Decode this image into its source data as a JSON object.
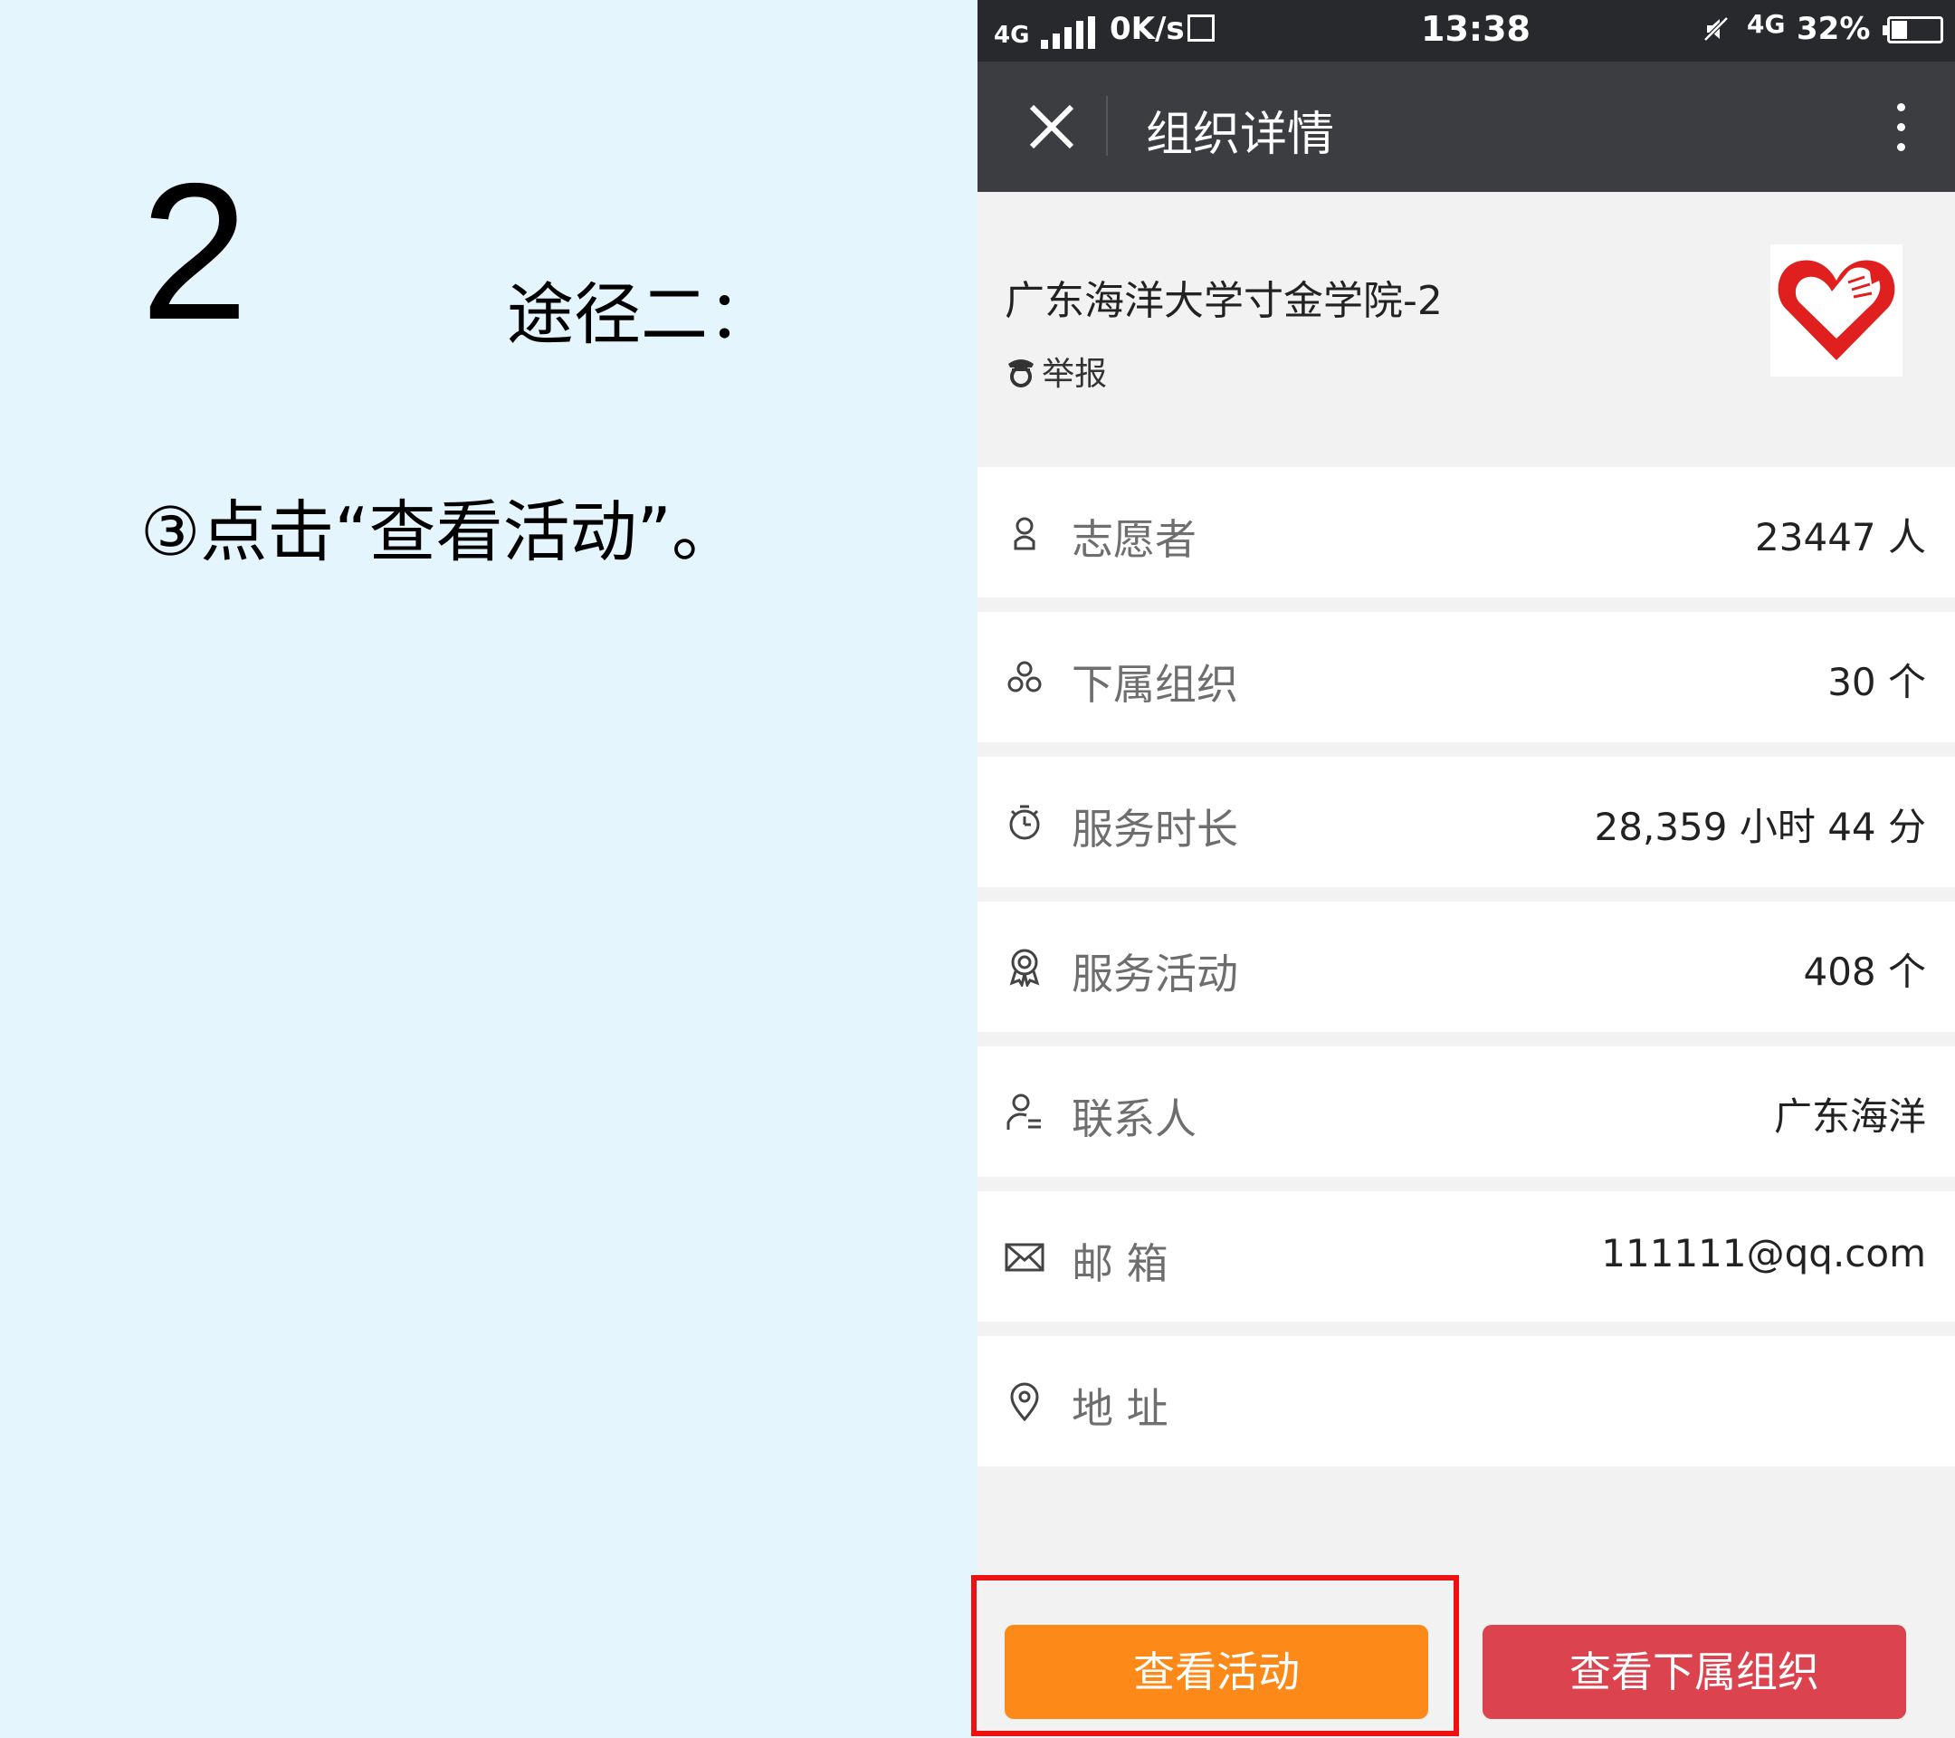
{
  "slide": {
    "step_number": "2",
    "route_title": "途径二：",
    "instruction": "③点击“查看活动”。"
  },
  "status_bar": {
    "signal_type": "4G",
    "speed": "0K/s",
    "time": "13:38",
    "network": "4G",
    "battery_percent": "32%",
    "battery_level": 0.32,
    "icons": [
      "signal-bars-icon",
      "screenshot-icon",
      "mute-icon",
      "battery-icon"
    ]
  },
  "nav": {
    "title": "组织详情",
    "close_icon": "close-icon",
    "more_icon": "more-vertical-icon",
    "background": "#3c3d41"
  },
  "organization": {
    "name": "广东海洋大学寸金学院-2",
    "report_label": "举报",
    "report_icon": "police-badge-icon",
    "logo_icon": "volunteer-heart-hand-logo"
  },
  "info_rows": [
    {
      "icon": "person-icon",
      "label": "志愿者",
      "value": "23447 人"
    },
    {
      "icon": "organization-icon",
      "label": "下属组织",
      "value": "30 个"
    },
    {
      "icon": "stopwatch-icon",
      "label": "服务时长",
      "value": "28,359 小时 44 分"
    },
    {
      "icon": "medal-icon",
      "label": "服务活动",
      "value": "408 个"
    },
    {
      "icon": "contact-person-icon",
      "label": "联系人",
      "value": "广东海洋"
    },
    {
      "icon": "mail-icon",
      "label": "邮 箱",
      "value": "111111@qq.com"
    },
    {
      "icon": "location-pin-icon",
      "label": "地 址",
      "value": ""
    }
  ],
  "buttons": {
    "view_activities": "查看活动",
    "view_suborgs": "查看下属组织"
  },
  "colors": {
    "slide_background": "#e4f5fd",
    "activities_button": "#fd8a18",
    "suborgs_button": "#db434f",
    "highlight": "#ee1111"
  }
}
